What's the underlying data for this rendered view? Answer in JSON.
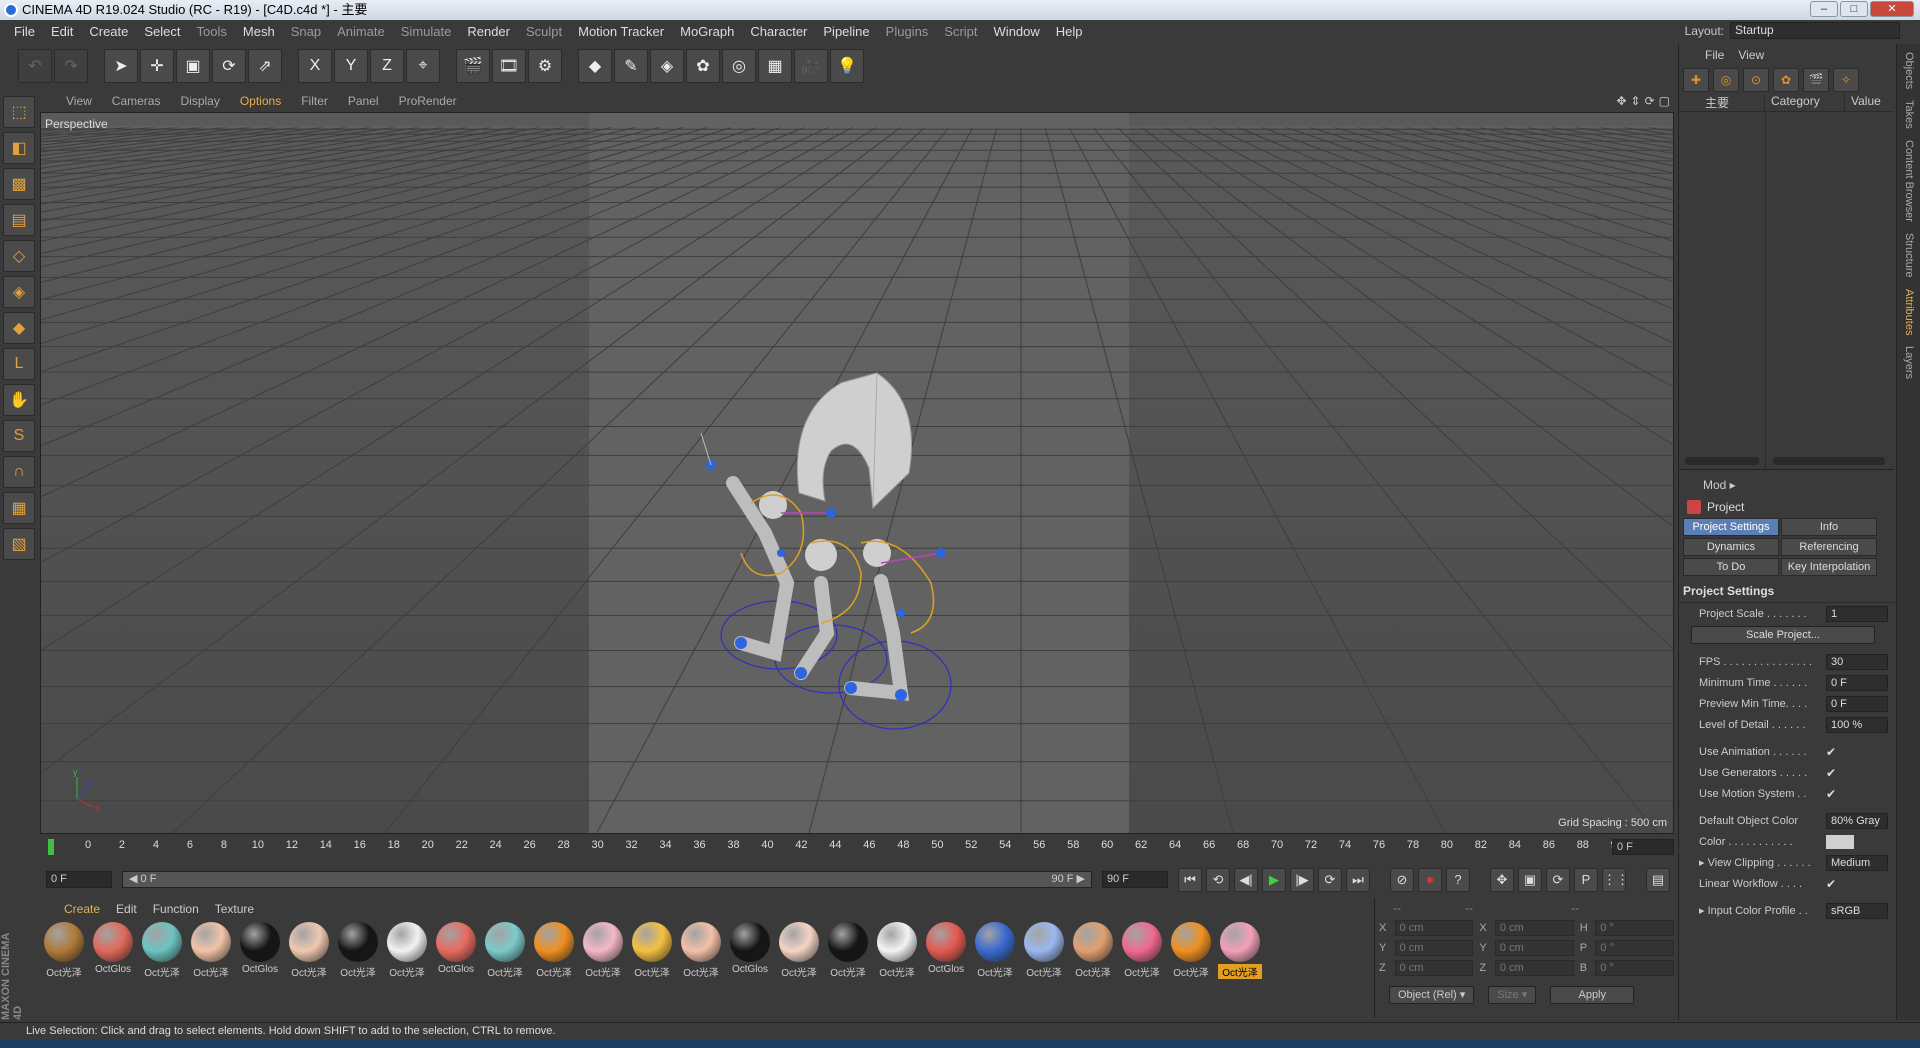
{
  "window": {
    "title": "CINEMA 4D R19.024 Studio (RC - R19) - [C4D.c4d *] - 主要"
  },
  "menu": [
    "File",
    "Edit",
    "Create",
    "Select",
    "Tools",
    "Mesh",
    "Snap",
    "Animate",
    "Simulate",
    "Render",
    "Sculpt",
    "Motion Tracker",
    "MoGraph",
    "Character",
    "Pipeline",
    "Plugins",
    "Script",
    "Window",
    "Help"
  ],
  "layout": {
    "label": "Layout:",
    "value": "Startup"
  },
  "toolbar_icons": [
    "undo-icon",
    "redo-icon",
    "live-selection-icon",
    "move-icon",
    "scale-icon",
    "rotate-icon",
    "recent-tool-icon",
    "x-axis-icon",
    "y-axis-icon",
    "z-axis-icon",
    "world-coords-icon",
    "render-view-icon",
    "render-picture-viewer-icon",
    "render-settings-icon",
    "cube-icon",
    "pen-icon",
    "subdivision-icon",
    "cloner-icon",
    "deformer-icon",
    "floor-icon",
    "camera-icon",
    "light-icon"
  ],
  "toolbar_glyphs": [
    "↶",
    "↷",
    "➤",
    "✛",
    "▣",
    "⟳",
    "⇗",
    "X",
    "Y",
    "Z",
    "⌖",
    "🎬",
    "🎞",
    "⚙",
    "◆",
    "✎",
    "◈",
    "✿",
    "◎",
    "▦",
    "🎥",
    "💡"
  ],
  "left_tools": [
    {
      "icon": "make-editable-icon",
      "glyph": "⬚"
    },
    {
      "icon": "model-mode-icon",
      "glyph": "◧"
    },
    {
      "icon": "texture-mode-icon",
      "glyph": "▩"
    },
    {
      "icon": "workplane-icon",
      "glyph": "▤"
    },
    {
      "icon": "points-mode-icon",
      "glyph": "◇"
    },
    {
      "icon": "edges-mode-icon",
      "glyph": "◈"
    },
    {
      "icon": "polygons-mode-icon",
      "glyph": "◆"
    },
    {
      "icon": "enable-axis-icon",
      "glyph": "L"
    },
    {
      "icon": "tweak-icon",
      "glyph": "✋"
    },
    {
      "icon": "solo-icon",
      "glyph": "S"
    },
    {
      "icon": "snap-icon",
      "glyph": "∩"
    },
    {
      "icon": "lock-workplane-icon",
      "glyph": "▦"
    },
    {
      "icon": "planar-workplane-icon",
      "glyph": "▧"
    }
  ],
  "viewport": {
    "menu": [
      "View",
      "Cameras",
      "Display",
      "Options",
      "Filter",
      "Panel",
      "ProRender"
    ],
    "active_menu": "Options",
    "label": "Perspective",
    "grid_spacing": "Grid Spacing : 500 cm"
  },
  "timeline": {
    "ticks": [
      "0",
      "2",
      "4",
      "6",
      "8",
      "10",
      "12",
      "14",
      "16",
      "18",
      "20",
      "22",
      "24",
      "26",
      "28",
      "30",
      "32",
      "34",
      "36",
      "38",
      "40",
      "42",
      "44",
      "46",
      "48",
      "50",
      "52",
      "54",
      "56",
      "58",
      "60",
      "62",
      "64",
      "66",
      "68",
      "70",
      "72",
      "74",
      "76",
      "78",
      "80",
      "82",
      "84",
      "86",
      "88",
      "90"
    ],
    "end_field": "0 F",
    "start_field": "0 F",
    "slider_left": "◀ 0 F",
    "slider_right": "90 F ▶",
    "max_field": "90 F"
  },
  "playback_glyphs": [
    "⏮",
    "⟲",
    "◀|",
    "▶",
    "|▶",
    "⟳",
    "⏭",
    "⊘",
    "⏺",
    "?",
    "✥",
    "▣",
    "⟳",
    "P",
    "⋮⋮",
    "▤"
  ],
  "materials": {
    "menu": [
      "Create",
      "Edit",
      "Function",
      "Texture"
    ],
    "active_menu": "Create",
    "items": [
      {
        "label": "Oct光泽",
        "color": "#b07a3a"
      },
      {
        "label": "OctGlos",
        "color": "#e06a5a"
      },
      {
        "label": "Oct光泽",
        "color": "#6cc4c0"
      },
      {
        "label": "Oct光泽",
        "color": "#f2c4a8"
      },
      {
        "label": "OctGlos",
        "color": "#151515"
      },
      {
        "label": "Oct光泽",
        "color": "#f0c8b0"
      },
      {
        "label": "Oct光泽",
        "color": "#151515"
      },
      {
        "label": "Oct光泽",
        "color": "#f2f2f2"
      },
      {
        "label": "OctGlos",
        "color": "#e86a60"
      },
      {
        "label": "Oct光泽",
        "color": "#7ccaca"
      },
      {
        "label": "Oct光泽",
        "color": "#f09020"
      },
      {
        "label": "Oct光泽",
        "color": "#f4b8c8"
      },
      {
        "label": "Oct光泽",
        "color": "#f4c040"
      },
      {
        "label": "Oct光泽",
        "color": "#f4c0a8"
      },
      {
        "label": "OctGlos",
        "color": "#151515"
      },
      {
        "label": "Oct光泽",
        "color": "#f4d4c4"
      },
      {
        "label": "Oct光泽",
        "color": "#151515"
      },
      {
        "label": "Oct光泽",
        "color": "#f4f4f4"
      },
      {
        "label": "OctGlos",
        "color": "#e45a50"
      },
      {
        "label": "Oct光泽",
        "color": "#3a6ad0"
      },
      {
        "label": "Oct光泽",
        "color": "#9ab8f0"
      },
      {
        "label": "Oct光泽",
        "color": "#e0a070"
      },
      {
        "label": "Oct光泽",
        "color": "#f06a90"
      },
      {
        "label": "Oct光泽",
        "color": "#f09020"
      },
      {
        "label": "Oct光泽",
        "color": "#f4a0b8"
      }
    ],
    "selected_index": 24
  },
  "coordinates": {
    "header": [
      "--",
      "--",
      "--"
    ],
    "rows": [
      {
        "a": "X",
        "av": "0 cm",
        "b": "X",
        "bv": "0 cm",
        "c": "H",
        "cv": "0 °"
      },
      {
        "a": "Y",
        "av": "0 cm",
        "b": "Y",
        "bv": "0 cm",
        "c": "P",
        "cv": "0 °"
      },
      {
        "a": "Z",
        "av": "0 cm",
        "b": "Z",
        "bv": "0 cm",
        "c": "B",
        "cv": "0 °"
      }
    ],
    "mode": "Object (Rel) ▾",
    "size": "Size ▾",
    "apply": "Apply"
  },
  "status": "Live Selection: Click and drag to select elements. Hold down SHIFT to add to the selection, CTRL to remove.",
  "objects_panel": {
    "menu": [
      "File",
      "View"
    ],
    "tool_glyphs": [
      "✚",
      "◎",
      "⊙",
      "✿",
      "🎬",
      "✧"
    ],
    "tree_item": "主要",
    "col_category": "Category",
    "col_value": "Value"
  },
  "attributes": {
    "mode": "Mod ▸",
    "object": "Project",
    "tabs": [
      {
        "label": "Project Settings",
        "active": true
      },
      {
        "label": "Info",
        "active": false
      },
      {
        "label": "Dynamics",
        "active": false
      },
      {
        "label": "Referencing",
        "active": false
      },
      {
        "label": "To Do",
        "active": false
      },
      {
        "label": "Key Interpolation",
        "active": false
      }
    ],
    "section": "Project Settings",
    "rows": [
      {
        "label": "Project Scale . . . . . . .",
        "value": "1",
        "type": "field"
      },
      {
        "label": "Scale Project...",
        "type": "button"
      },
      {
        "label": "FPS . . . . . . . . . . . . . . .",
        "value": "30",
        "type": "field"
      },
      {
        "label": "Minimum Time . . . . . .",
        "value": "0 F",
        "type": "field"
      },
      {
        "label": "Preview Min Time. . . .",
        "value": "0 F",
        "type": "field"
      },
      {
        "label": "Level of Detail . . . . . .",
        "value": "100 %",
        "type": "field"
      },
      {
        "label": "Use Animation . . . . . .",
        "value": "✔",
        "type": "check"
      },
      {
        "label": "Use Generators . . . . .",
        "value": "✔",
        "type": "check"
      },
      {
        "label": "Use Motion System . .",
        "value": "✔",
        "type": "check"
      },
      {
        "label": "Default Object Color",
        "value": "80% Gray",
        "type": "field"
      },
      {
        "label": "Color . . . . . . . . . . .",
        "value": "",
        "type": "swatch"
      },
      {
        "label": "▸ View Clipping . . . . . .",
        "value": "Medium",
        "type": "field"
      },
      {
        "label": "Linear Workflow . . . .",
        "value": "✔",
        "type": "check"
      },
      {
        "label": "▸ Input Color Profile . .",
        "value": "sRGB",
        "type": "field"
      }
    ]
  },
  "side_tabs": [
    "Objects",
    "Takes",
    "Content Browser",
    "Structure",
    "Attributes",
    "Layers"
  ],
  "active_side_tab": "Attributes",
  "logo_text": "MAXON CINEMA 4D"
}
